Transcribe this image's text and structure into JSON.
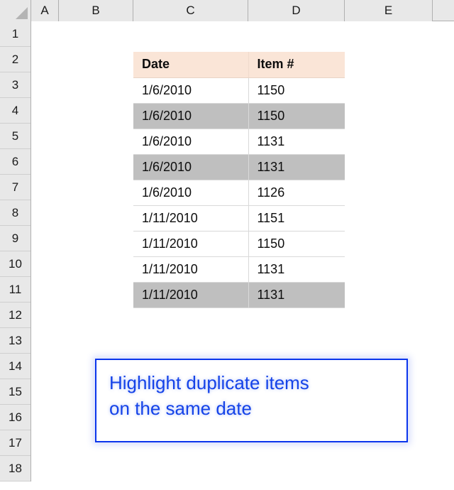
{
  "app": {
    "type": "spreadsheet",
    "gridlines_visible": false,
    "background_color": "#ffffff"
  },
  "grid": {
    "corner_icon": "select-all-triangle-icon",
    "column_headers": [
      {
        "label": "A",
        "width": 39
      },
      {
        "label": "B",
        "width": 105
      },
      {
        "label": "C",
        "width": 162
      },
      {
        "label": "D",
        "width": 136
      },
      {
        "label": "E",
        "width": 124
      }
    ],
    "row_headers": [
      "1",
      "2",
      "3",
      "4",
      "5",
      "6",
      "7",
      "8",
      "9",
      "10",
      "11",
      "12",
      "13",
      "14",
      "15",
      "16",
      "17",
      "18"
    ],
    "header_fill": "#e8e8e8",
    "header_text_color": "#1a1a1a",
    "header_border": "#b0b0b0"
  },
  "table": {
    "anchor_cell": "C2",
    "header_fill": "#fae5d7",
    "duplicate_fill": "#bfbfbf",
    "normal_fill": "#ffffff",
    "border_color": "#d9d9d9",
    "columns": [
      "Date",
      "Item #"
    ],
    "rows": [
      {
        "row": "3",
        "date": "1/6/2010",
        "item": "1150",
        "duplicate": false
      },
      {
        "row": "4",
        "date": "1/6/2010",
        "item": "1150",
        "duplicate": true
      },
      {
        "row": "5",
        "date": "1/6/2010",
        "item": "1131",
        "duplicate": false
      },
      {
        "row": "6",
        "date": "1/6/2010",
        "item": "1131",
        "duplicate": true
      },
      {
        "row": "7",
        "date": "1/6/2010",
        "item": "1126",
        "duplicate": false
      },
      {
        "row": "8",
        "date": "1/11/2010",
        "item": "1151",
        "duplicate": false
      },
      {
        "row": "9",
        "date": "1/11/2010",
        "item": "1150",
        "duplicate": false
      },
      {
        "row": "10",
        "date": "1/11/2010",
        "item": "1131",
        "duplicate": false
      },
      {
        "row": "11",
        "date": "1/11/2010",
        "item": "1131",
        "duplicate": true
      }
    ]
  },
  "callout": {
    "text": "Highlight duplicate items\non the same date",
    "text_color": "#1543e8",
    "border_color": "#0b35ec",
    "fill_color": "#ffffff"
  }
}
